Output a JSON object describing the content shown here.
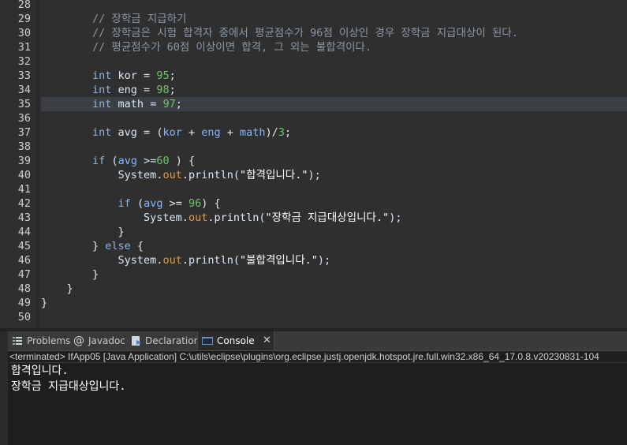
{
  "editor": {
    "current_line": "35",
    "lines": [
      {
        "n": "28",
        "tokens": []
      },
      {
        "n": "29",
        "tokens": [
          {
            "c": "t-cm",
            "t": "        // 장학금 지급하기"
          }
        ]
      },
      {
        "n": "30",
        "tokens": [
          {
            "c": "t-cm",
            "t": "        // 장학금은 시험 합격자 중에서 평균점수가 96점 이상인 경우 장학금 지급대상이 된다."
          }
        ]
      },
      {
        "n": "31",
        "tokens": [
          {
            "c": "t-cm",
            "t": "        // 평균점수가 60점 이상이면 합격, 그 외는 불합격이다."
          }
        ]
      },
      {
        "n": "32",
        "tokens": []
      },
      {
        "n": "33",
        "tokens": [
          {
            "c": "t-pl",
            "t": "        "
          },
          {
            "c": "t-kw",
            "t": "int"
          },
          {
            "c": "t-pl",
            "t": " kor = "
          },
          {
            "c": "t-num",
            "t": "95"
          },
          {
            "c": "t-pl",
            "t": ";"
          }
        ]
      },
      {
        "n": "34",
        "tokens": [
          {
            "c": "t-pl",
            "t": "        "
          },
          {
            "c": "t-kw",
            "t": "int"
          },
          {
            "c": "t-pl",
            "t": " eng = "
          },
          {
            "c": "t-num",
            "t": "98"
          },
          {
            "c": "t-pl",
            "t": ";"
          }
        ]
      },
      {
        "n": "35",
        "tokens": [
          {
            "c": "t-pl",
            "t": "        "
          },
          {
            "c": "t-kw",
            "t": "int"
          },
          {
            "c": "t-pl",
            "t": " math = "
          },
          {
            "c": "t-num",
            "t": "97"
          },
          {
            "c": "t-pl",
            "t": ";"
          }
        ]
      },
      {
        "n": "36",
        "tokens": []
      },
      {
        "n": "37",
        "tokens": [
          {
            "c": "t-pl",
            "t": "        "
          },
          {
            "c": "t-kw",
            "t": "int"
          },
          {
            "c": "t-pl",
            "t": " avg = ("
          },
          {
            "c": "t-var",
            "t": "kor"
          },
          {
            "c": "t-pl",
            "t": " + "
          },
          {
            "c": "t-var",
            "t": "eng"
          },
          {
            "c": "t-pl",
            "t": " + "
          },
          {
            "c": "t-var",
            "t": "math"
          },
          {
            "c": "t-pl",
            "t": ")/"
          },
          {
            "c": "t-num",
            "t": "3"
          },
          {
            "c": "t-pl",
            "t": ";"
          }
        ]
      },
      {
        "n": "38",
        "tokens": []
      },
      {
        "n": "39",
        "tokens": [
          {
            "c": "t-pl",
            "t": "        "
          },
          {
            "c": "t-kw",
            "t": "if"
          },
          {
            "c": "t-pl",
            "t": " ("
          },
          {
            "c": "t-var",
            "t": "avg"
          },
          {
            "c": "t-pl",
            "t": " >="
          },
          {
            "c": "t-num",
            "t": "60"
          },
          {
            "c": "t-pl",
            "t": " ) {"
          }
        ]
      },
      {
        "n": "40",
        "tokens": [
          {
            "c": "t-pl",
            "t": "            System."
          },
          {
            "c": "t-fld",
            "t": "out"
          },
          {
            "c": "t-pl",
            "t": ".println("
          },
          {
            "c": "t-str",
            "t": "\"합격입니다.\""
          },
          {
            "c": "t-pl",
            "t": ");"
          }
        ]
      },
      {
        "n": "41",
        "tokens": []
      },
      {
        "n": "42",
        "tokens": [
          {
            "c": "t-pl",
            "t": "            "
          },
          {
            "c": "t-kw",
            "t": "if"
          },
          {
            "c": "t-pl",
            "t": " ("
          },
          {
            "c": "t-var",
            "t": "avg"
          },
          {
            "c": "t-pl",
            "t": " >= "
          },
          {
            "c": "t-num",
            "t": "96"
          },
          {
            "c": "t-pl",
            "t": ") {"
          }
        ]
      },
      {
        "n": "43",
        "tokens": [
          {
            "c": "t-pl",
            "t": "                System."
          },
          {
            "c": "t-fld",
            "t": "out"
          },
          {
            "c": "t-pl",
            "t": ".println("
          },
          {
            "c": "t-str",
            "t": "\"장학금 지급대상입니다.\""
          },
          {
            "c": "t-pl",
            "t": ");"
          }
        ]
      },
      {
        "n": "44",
        "tokens": [
          {
            "c": "t-pl",
            "t": "            }"
          }
        ]
      },
      {
        "n": "45",
        "tokens": [
          {
            "c": "t-pl",
            "t": "        } "
          },
          {
            "c": "t-kw",
            "t": "else"
          },
          {
            "c": "t-pl",
            "t": " {"
          }
        ]
      },
      {
        "n": "46",
        "tokens": [
          {
            "c": "t-pl",
            "t": "            System."
          },
          {
            "c": "t-fld",
            "t": "out"
          },
          {
            "c": "t-pl",
            "t": ".println("
          },
          {
            "c": "t-str",
            "t": "\"불합격입니다.\""
          },
          {
            "c": "t-pl",
            "t": ");"
          }
        ]
      },
      {
        "n": "47",
        "tokens": [
          {
            "c": "t-pl",
            "t": "        }"
          }
        ]
      },
      {
        "n": "48",
        "tokens": [
          {
            "c": "t-pl",
            "t": "    }"
          }
        ]
      },
      {
        "n": "49",
        "tokens": [
          {
            "c": "t-pl",
            "t": "}"
          }
        ]
      },
      {
        "n": "50",
        "tokens": []
      }
    ]
  },
  "panel": {
    "tabs": [
      {
        "label": "Problems",
        "icon": "problems-icon"
      },
      {
        "label": "Javadoc",
        "icon": "at-icon"
      },
      {
        "label": "Declaration",
        "icon": "declaration-icon"
      },
      {
        "label": "Console",
        "icon": "console-icon"
      }
    ],
    "active_tab": "Console",
    "terminated_line": "<terminated> IfApp05 [Java Application] C:\\utils\\eclipse\\plugins\\org.eclipse.justj.openjdk.hotspot.jre.full.win32.x86_64_17.0.8.v20230831-104",
    "output": [
      "합격입니다.",
      "장학금 지급대상입니다."
    ]
  },
  "colors": {
    "editor_bg": "#2f2f2f",
    "current_line_bg": "#3b3f43",
    "keyword": "#8fb4e0",
    "comment": "#8a98a8",
    "number": "#6fc66c",
    "field": "#e69b47"
  }
}
